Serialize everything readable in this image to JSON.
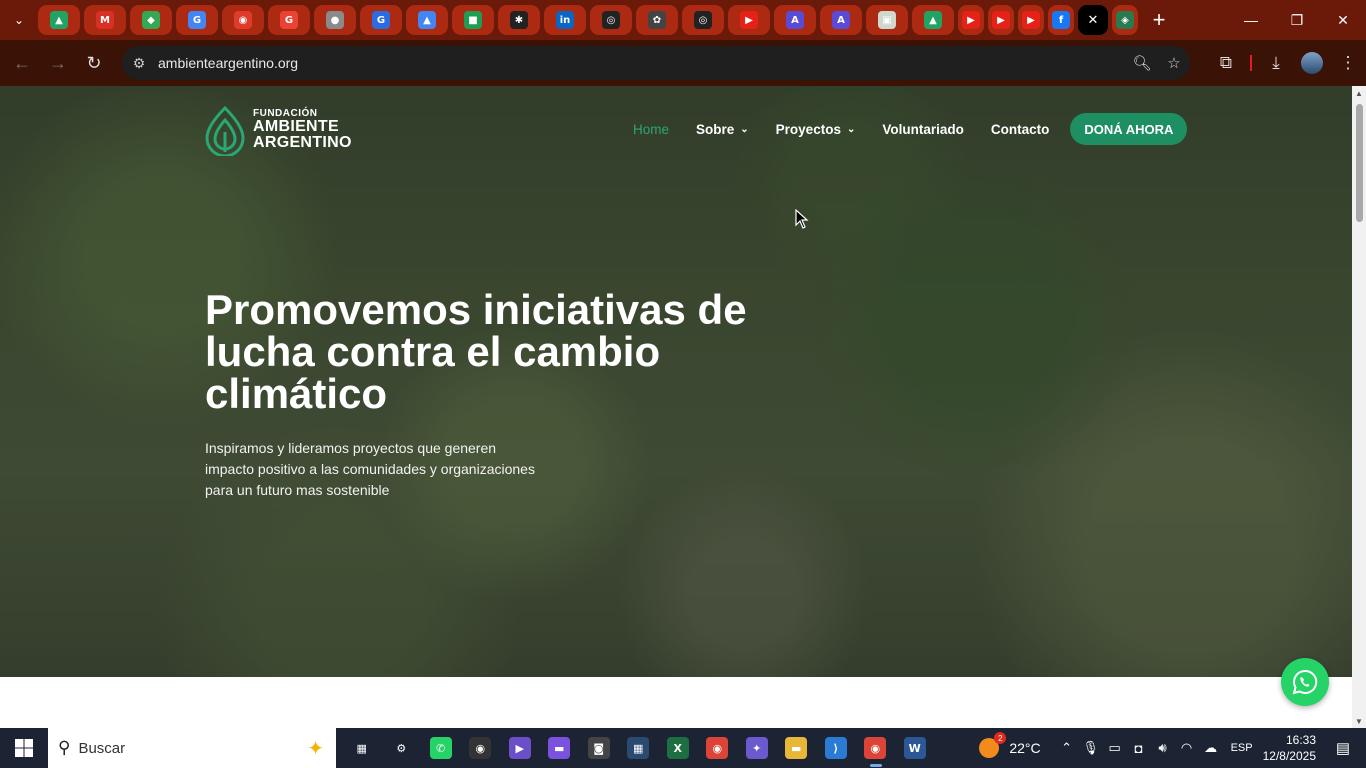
{
  "browser": {
    "tabs": [
      {
        "icon": "google-drive-icon",
        "glyph": "▲",
        "color": "#1fa463"
      },
      {
        "icon": "gmail-icon",
        "glyph": "M",
        "color": "#d93025"
      },
      {
        "icon": "google-maps-icon",
        "glyph": "◆",
        "color": "#34a853"
      },
      {
        "icon": "google-translate-icon",
        "glyph": "G",
        "color": "#4285f4"
      },
      {
        "icon": "chrome-web-store-icon",
        "glyph": "◉",
        "color": "#e03a2a"
      },
      {
        "icon": "google-icon",
        "glyph": "G",
        "color": "#ea4335"
      },
      {
        "icon": "globe-icon",
        "glyph": "●",
        "color": "#8a8a8a"
      },
      {
        "icon": "grammar-icon",
        "glyph": "G",
        "color": "#2b6de0"
      },
      {
        "icon": "ads-icon",
        "glyph": "▲",
        "color": "#4285f4"
      },
      {
        "icon": "sheets-app-icon",
        "glyph": "■",
        "color": "#1e9d55"
      },
      {
        "icon": "asterisk-app-icon",
        "glyph": "✱",
        "color": "#222"
      },
      {
        "icon": "linkedin-icon",
        "glyph": "in",
        "color": "#0a66c2"
      },
      {
        "icon": "github-icon",
        "glyph": "◎",
        "color": "#222"
      },
      {
        "icon": "openai-icon",
        "glyph": "✿",
        "color": "#444"
      },
      {
        "icon": "github-icon",
        "glyph": "◎",
        "color": "#222"
      },
      {
        "icon": "youtube-icon",
        "glyph": "▶",
        "color": "#e62117"
      },
      {
        "icon": "app-store-icon",
        "glyph": "A",
        "color": "#5a4bd6"
      },
      {
        "icon": "app-store-icon",
        "glyph": "A",
        "color": "#5a4bd6"
      },
      {
        "icon": "document-icon",
        "glyph": "▣",
        "color": "#cfd8cc"
      },
      {
        "icon": "google-drive-icon",
        "glyph": "▲",
        "color": "#1fa463"
      },
      {
        "icon": "youtube-icon",
        "glyph": "▶",
        "color": "#e62117",
        "small": true
      },
      {
        "icon": "youtube-icon",
        "glyph": "▶",
        "color": "#e62117",
        "small": true
      },
      {
        "icon": "youtube-icon",
        "glyph": "▶",
        "color": "#e62117",
        "small": true
      },
      {
        "icon": "facebook-icon",
        "glyph": "f",
        "color": "#1877f2",
        "small": true
      },
      {
        "icon": "close-icon",
        "glyph": "✕",
        "color": "#000",
        "active": true
      },
      {
        "icon": "site-favicon-icon",
        "glyph": "◈",
        "color": "#2a7a50",
        "small": true
      }
    ],
    "url": "ambienteargentino.org"
  },
  "site": {
    "logo_line1": "FUNDACIÓN",
    "logo_line2": "AMBIENTE",
    "logo_line3": "ARGENTINO",
    "nav": {
      "home": "Home",
      "sobre": "Sobre",
      "proyectos": "Proyectos",
      "voluntariado": "Voluntariado",
      "contacto": "Contacto",
      "donate": "DONÁ AHORA"
    },
    "hero_title": "Promovemos iniciativas de lucha contra el cambio climático",
    "hero_subtitle": "Inspiramos y lideramos proyectos que generen impacto positivo a las comunidades y organizaciones para un futuro mas sostenible",
    "accent": "#1e8f63"
  },
  "taskbar": {
    "search_placeholder": "Buscar",
    "apps": [
      {
        "icon": "task-view-icon",
        "glyph": "▦",
        "color": "#1c2433"
      },
      {
        "icon": "settings-icon",
        "glyph": "⚙",
        "color": "#1c2433"
      },
      {
        "icon": "whatsapp-icon",
        "glyph": "✆",
        "color": "#25d366"
      },
      {
        "icon": "obs-icon",
        "glyph": "◉",
        "color": "#333"
      },
      {
        "icon": "media-player-icon",
        "glyph": "▶",
        "color": "#6b4fc8"
      },
      {
        "icon": "clipchamp-icon",
        "glyph": "▬",
        "color": "#7b52e0"
      },
      {
        "icon": "camera-icon",
        "glyph": "◙",
        "color": "#444"
      },
      {
        "icon": "calculator-icon",
        "glyph": "▦",
        "color": "#2a4a70"
      },
      {
        "icon": "excel-icon",
        "glyph": "X",
        "color": "#1d6f42"
      },
      {
        "icon": "chrome-icon",
        "glyph": "◉",
        "color": "#db4437"
      },
      {
        "icon": "copilot-icon",
        "glyph": "✦",
        "color": "#6a5acd"
      },
      {
        "icon": "file-explorer-icon",
        "glyph": "▬",
        "color": "#e8b73a"
      },
      {
        "icon": "vscode-icon",
        "glyph": "⟩",
        "color": "#2a7bd4"
      },
      {
        "icon": "chrome-profile-icon",
        "glyph": "◉",
        "color": "#db4437",
        "open": true
      },
      {
        "icon": "word-icon",
        "glyph": "W",
        "color": "#2b5797"
      }
    ],
    "weather_badge": "2",
    "temperature": "22°C",
    "language": "ESP",
    "time": "16:33",
    "date": "12/8/2025"
  }
}
